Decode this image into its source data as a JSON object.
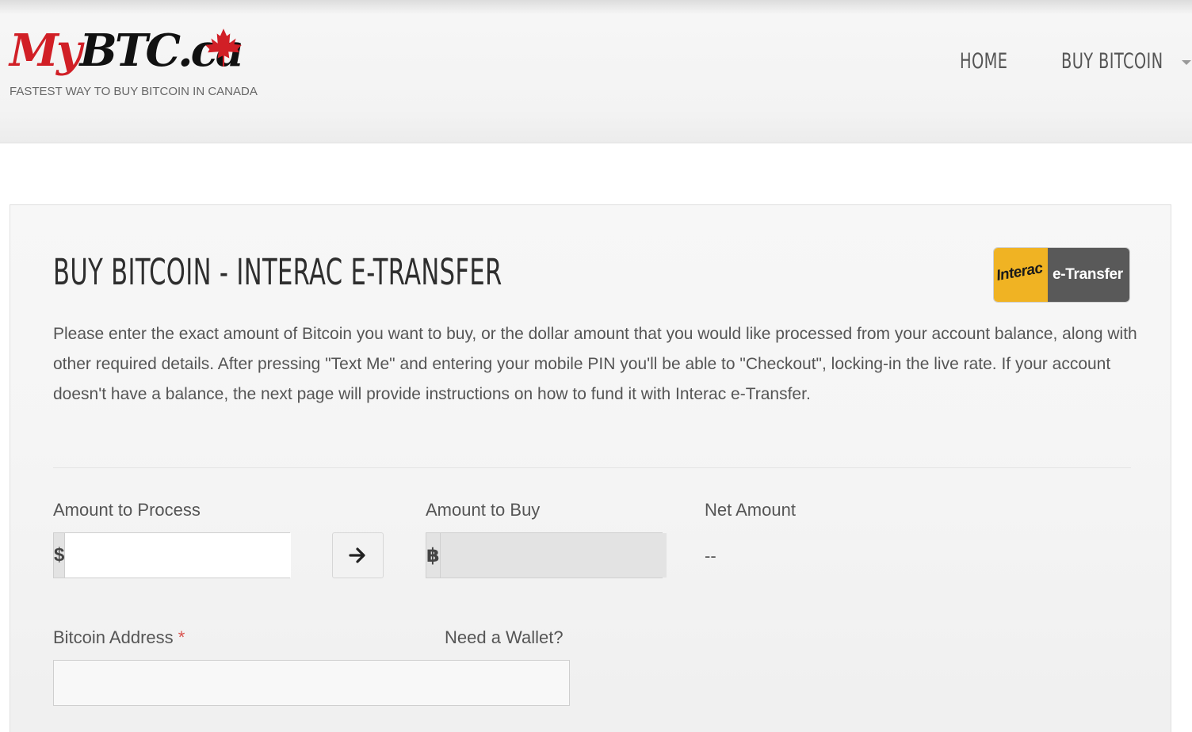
{
  "header": {
    "logo": {
      "my": "My",
      "btc": "BTC.ca"
    },
    "tagline": "FASTEST WAY TO BUY BITCOIN IN CANADA",
    "nav": {
      "home": "HOME",
      "buy_bitcoin": "BUY BITCOIN"
    }
  },
  "page": {
    "title": "BUY BITCOIN - INTERAC E-TRANSFER",
    "badge": {
      "left": "Interac",
      "right": "e-Transfer"
    },
    "description": "Please enter the exact amount of Bitcoin you want to buy, or the dollar amount that you would like processed from your account balance, along with other required details. After pressing \"Text Me\" and entering your mobile PIN you'll be able to \"Checkout\", locking-in the live rate. If your account doesn't have a balance, the next page will provide instructions on how to fund it with Interac e-Transfer."
  },
  "form": {
    "amount_to_process": {
      "label": "Amount to Process",
      "prefix": "$",
      "value": ""
    },
    "amount_to_buy": {
      "label": "Amount to Buy",
      "prefix": "฿",
      "value": ""
    },
    "net_amount": {
      "label": "Net Amount",
      "value": "--"
    },
    "bitcoin_address": {
      "label": "Bitcoin Address",
      "required_mark": "*",
      "value": ""
    },
    "need_wallet": "Need a Wallet?"
  },
  "colors": {
    "brand_red": "#d11f26",
    "interac_yellow": "#f0b323",
    "interac_gray": "#595959"
  },
  "icons": {
    "arrow": "arrow-right-icon",
    "maple": "maple-leaf-icon",
    "caret": "caret-down-icon"
  }
}
